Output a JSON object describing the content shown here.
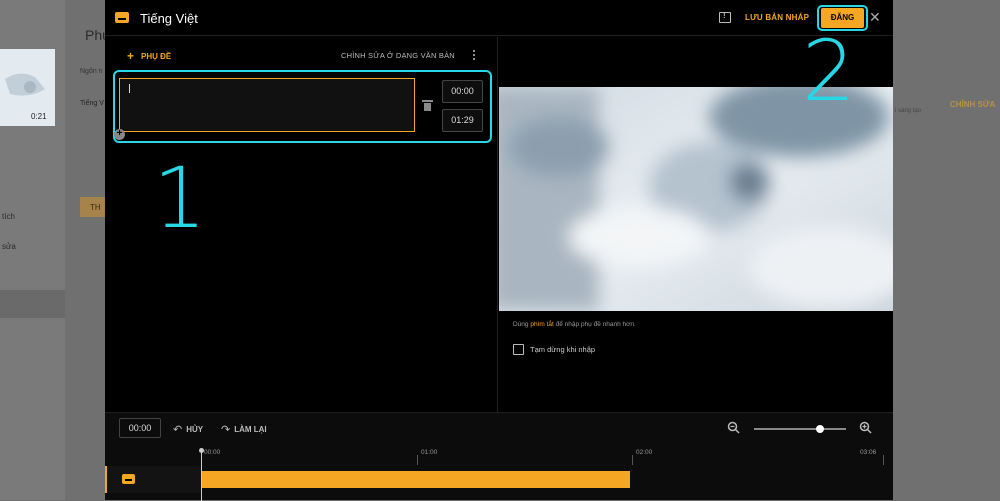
{
  "background": {
    "page_title": "Phụ",
    "thumb_duration": "0:21",
    "lang_label": "Ngôn n",
    "lang_row": "Tiếng V",
    "nav_1": "tích",
    "nav_2": "sửa",
    "btn": "TH",
    "edit_link": "CHỈNH SỬA",
    "edit_sub": "i sáng tạo"
  },
  "dialog": {
    "title": "Tiếng Việt",
    "save_draft": "LƯU BẢN NHÁP",
    "publish": "ĐĂNG"
  },
  "editor": {
    "add_subtitle": "PHỤ ĐỀ",
    "text_mode": "CHỈNH SỬA Ở DẠNG VĂN BẢN",
    "entries": [
      {
        "text": "",
        "start": "00:00",
        "end": "01:29"
      }
    ]
  },
  "player": {
    "hint_prefix": "Dùng ",
    "hint_link": "phím tắt",
    "hint_suffix": " để nhập phụ đề nhanh hơn.",
    "pause_label": "Tạm dừng khi nhập",
    "pause_checked": false
  },
  "timeline": {
    "current_time": "00:00",
    "undo": "HỦY",
    "redo": "LÀM LẠI",
    "ticks": [
      "00:00",
      "01:00",
      "02:00",
      "03:06"
    ],
    "zoom_level": 0.72
  },
  "annotations": {
    "n1": "1",
    "n2": "2"
  },
  "colors": {
    "accent": "#f5a623",
    "highlight": "#26d7e6"
  }
}
